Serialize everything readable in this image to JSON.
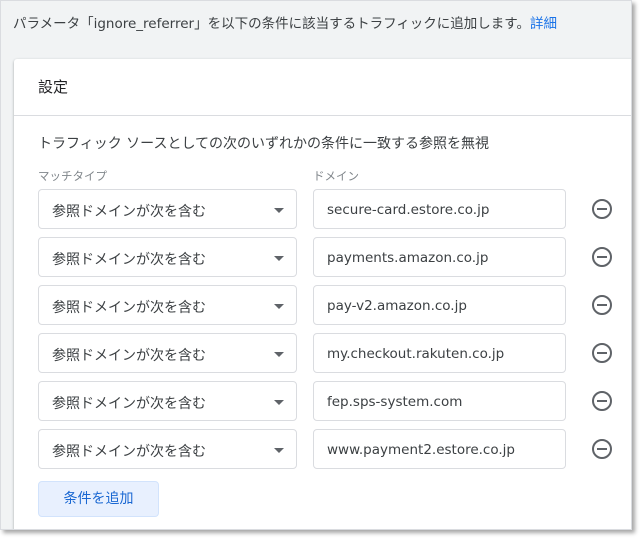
{
  "intro": {
    "text": "パラメータ「ignore_referrer」を以下の条件に該当するトラフィックに追加します。",
    "link": "詳細"
  },
  "card": {
    "title": "設定",
    "description": "トラフィック ソースとしての次のいずれかの条件に一致する参照を無視",
    "match_type_label": "マッチタイプ",
    "domain_label": "ドメイン",
    "rows": [
      {
        "match_type": "参照ドメインが次を含む",
        "domain": "secure-card.estore.co.jp"
      },
      {
        "match_type": "参照ドメインが次を含む",
        "domain": "payments.amazon.co.jp"
      },
      {
        "match_type": "参照ドメインが次を含む",
        "domain": "pay-v2.amazon.co.jp"
      },
      {
        "match_type": "参照ドメインが次を含む",
        "domain": "my.checkout.rakuten.co.jp"
      },
      {
        "match_type": "参照ドメインが次を含む",
        "domain": "fep.sps-system.com"
      },
      {
        "match_type": "参照ドメインが次を含む",
        "domain": "www.payment2.estore.co.jp"
      }
    ],
    "add_button": "条件を追加"
  },
  "icons": {
    "dropdown": "arrow-drop-down-icon",
    "remove": "remove-circle-outline-icon"
  },
  "colors": {
    "link": "#1a73e8",
    "button_bg": "#e8f0fe",
    "button_text": "#1967d2",
    "page_bg": "#f1f3f4"
  }
}
